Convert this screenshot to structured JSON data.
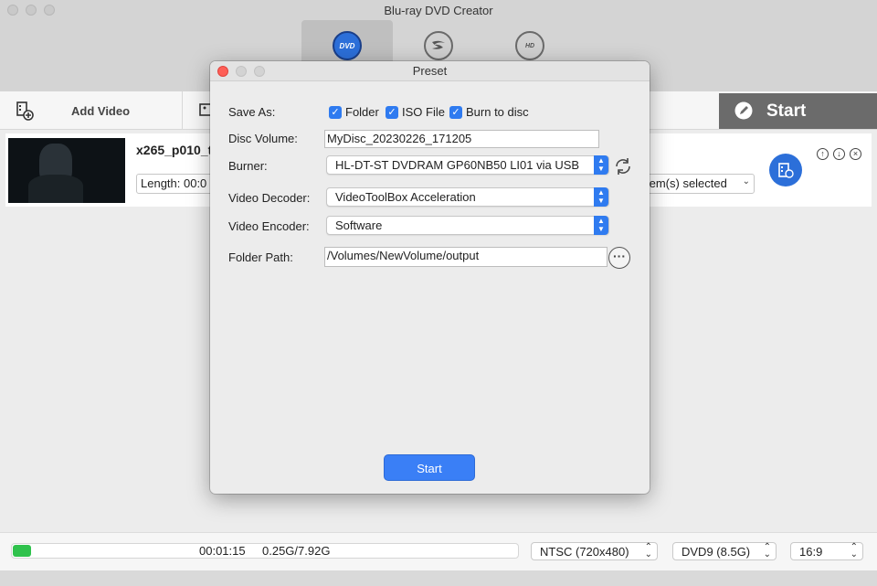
{
  "app": {
    "title": "Blu-ray DVD Creator"
  },
  "modes": [
    {
      "label": "DVD",
      "icon": "dvd-disc-icon"
    },
    {
      "label": "",
      "icon": "bluray-disc-icon"
    },
    {
      "label": "",
      "icon": "uhd-disc-icon"
    }
  ],
  "toolbar": {
    "add_video_label": "Add Video",
    "start_label": "Start"
  },
  "video": {
    "title": "x265_p010_t",
    "length_label": "Length: 00:0",
    "subtitle_select": "tem(s) selected"
  },
  "status": {
    "progress_fraction": 0.036,
    "time": "00:01:15",
    "size": "0.25G/7.92G",
    "format": "NTSC (720x480)",
    "disc_type": "DVD9 (8.5G)",
    "aspect": "16:9",
    "progress_color": "#2fc24c"
  },
  "dialog": {
    "title": "Preset",
    "save_as_label": "Save As:",
    "options": [
      {
        "label": "Folder",
        "checked": true
      },
      {
        "label": "ISO File",
        "checked": true
      },
      {
        "label": "Burn to disc",
        "checked": true
      }
    ],
    "disc_volume_label": "Disc Volume:",
    "disc_volume_value": "MyDisc_20230226_171205",
    "burner_label": "Burner:",
    "burner_value": "HL-DT-ST DVDRAM GP60NB50 LI01 via USB",
    "video_decoder_label": "Video Decoder:",
    "video_decoder_value": "VideoToolBox Acceleration",
    "video_encoder_label": "Video Encoder:",
    "video_encoder_value": "Software",
    "folder_path_label": "Folder Path:",
    "folder_path_value": "/Volumes/NewVolume/output",
    "start_label": "Start",
    "accent_color": "#2f7bf0"
  }
}
